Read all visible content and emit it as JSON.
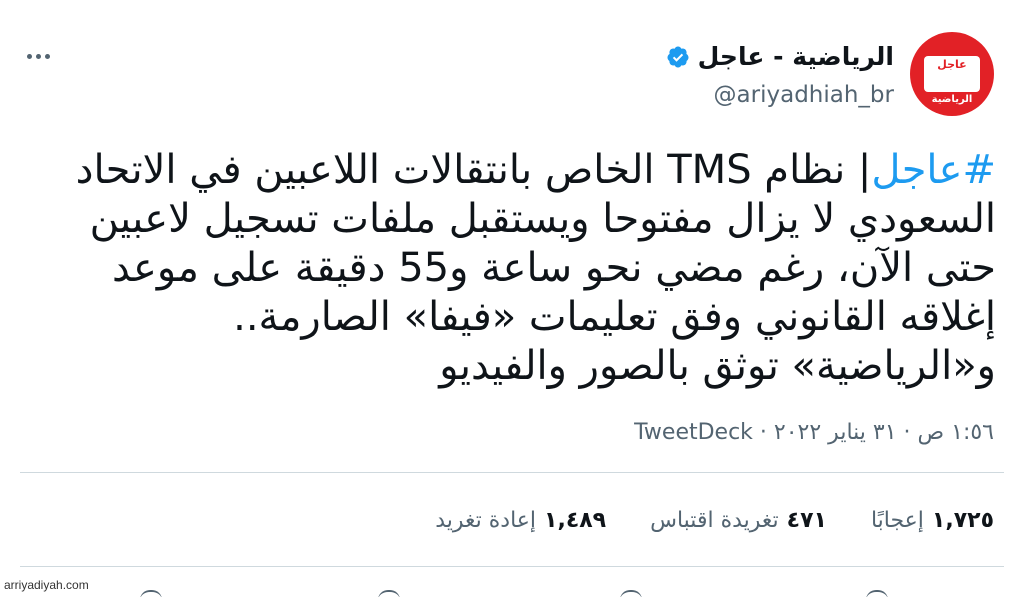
{
  "author": {
    "display_name": "الرياضية - عاجل",
    "handle": "@ariyadhiah_br",
    "avatar_text_top": "عاجل",
    "avatar_text_bottom": "الرياضية"
  },
  "tweet": {
    "hashtag": "#عاجل",
    "text": "| نظام TMS الخاص بانتقالات اللاعبين في الاتحاد السعودي لا يزال مفتوحا ويستقبل ملفات تسجيل لاعبين حتى الآن، رغم مضي نحو ساعة و55 دقيقة على موعد إغلاقه القانوني وفق تعليمات «فيفا» الصارمة.. و«الرياضية» توثق بالصور والفيديو",
    "timestamp": "١:٥٦ ص · ٣١ يناير ٢٠٢٢ · ",
    "source": "TweetDeck"
  },
  "stats": {
    "retweets_count": "١,٤٨٩",
    "retweets_label": "إعادة تغريد",
    "quotes_count": "٤٧١",
    "quotes_label": "تغريدة اقتباس",
    "likes_count": "١,٧٢٥",
    "likes_label": "إعجابًا"
  },
  "watermark": "arriyadiyah.com",
  "colors": {
    "accent": "#1d9bf0",
    "avatar_red": "#e22126",
    "muted": "#536471"
  }
}
